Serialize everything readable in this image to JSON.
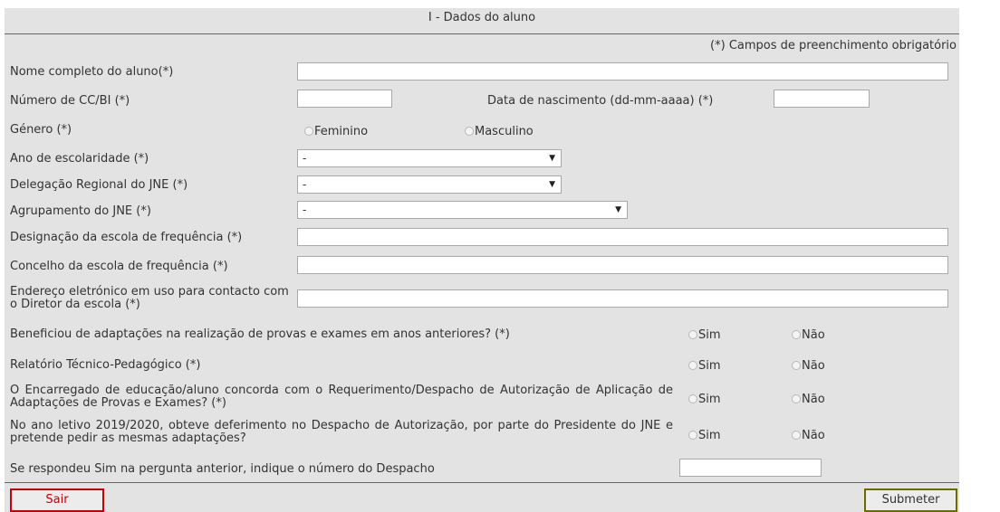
{
  "section_title": "I - Dados do aluno",
  "required_note": "(*) Campos de preenchimento obrigatório",
  "fields": {
    "nome": {
      "label": "Nome completo do aluno(*)",
      "value": ""
    },
    "cc": {
      "label": "Número de CC/BI (*)",
      "value": ""
    },
    "data_nasc": {
      "label": "Data de nascimento (dd-mm-aaaa) (*)",
      "value": ""
    },
    "genero": {
      "label": "Género (*)",
      "options": [
        "Feminino",
        "Masculino"
      ]
    },
    "ano": {
      "label": "Ano de escolaridade (*)",
      "selected": "-"
    },
    "delegacao": {
      "label": "Delegação Regional do JNE (*)",
      "selected": "-"
    },
    "agrupamento": {
      "label": "Agrupamento do JNE (*)",
      "selected": "-"
    },
    "escola": {
      "label": "Designação da escola de frequência (*)",
      "value": ""
    },
    "concelho": {
      "label": "Concelho da escola de frequência (*)",
      "value": ""
    },
    "email": {
      "label": "Endereço eletrónico em uso para contacto com o Diretor da escola (*)",
      "value": ""
    },
    "q1": {
      "label": "Beneficiou de adaptações na realização de provas e exames em anos anteriores? (*)"
    },
    "q2": {
      "label": "Relatório Técnico-Pedagógico (*)"
    },
    "q3": {
      "label": "O Encarregado de educação/aluno concorda com o Requerimento/Despacho de Autorização de Aplicação de Adaptações de Provas e Exames? (*)"
    },
    "q4": {
      "label": "No ano letivo 2019/2020, obteve deferimento no Despacho de Autorização, por parte do Presidente do JNE e pretende pedir as mesmas adaptações?"
    },
    "despacho": {
      "label": "Se respondeu Sim na pergunta anterior, indique o número do Despacho",
      "value": ""
    }
  },
  "yes_no": {
    "yes": "Sim",
    "no": "Não"
  },
  "buttons": {
    "sair": "Sair",
    "submeter": "Submeter"
  },
  "colors": {
    "form_bg": "#e3e3e3",
    "sair_border": "#cc0000",
    "sair_text": "#cc0000",
    "submeter_border": "#6b6b00"
  }
}
